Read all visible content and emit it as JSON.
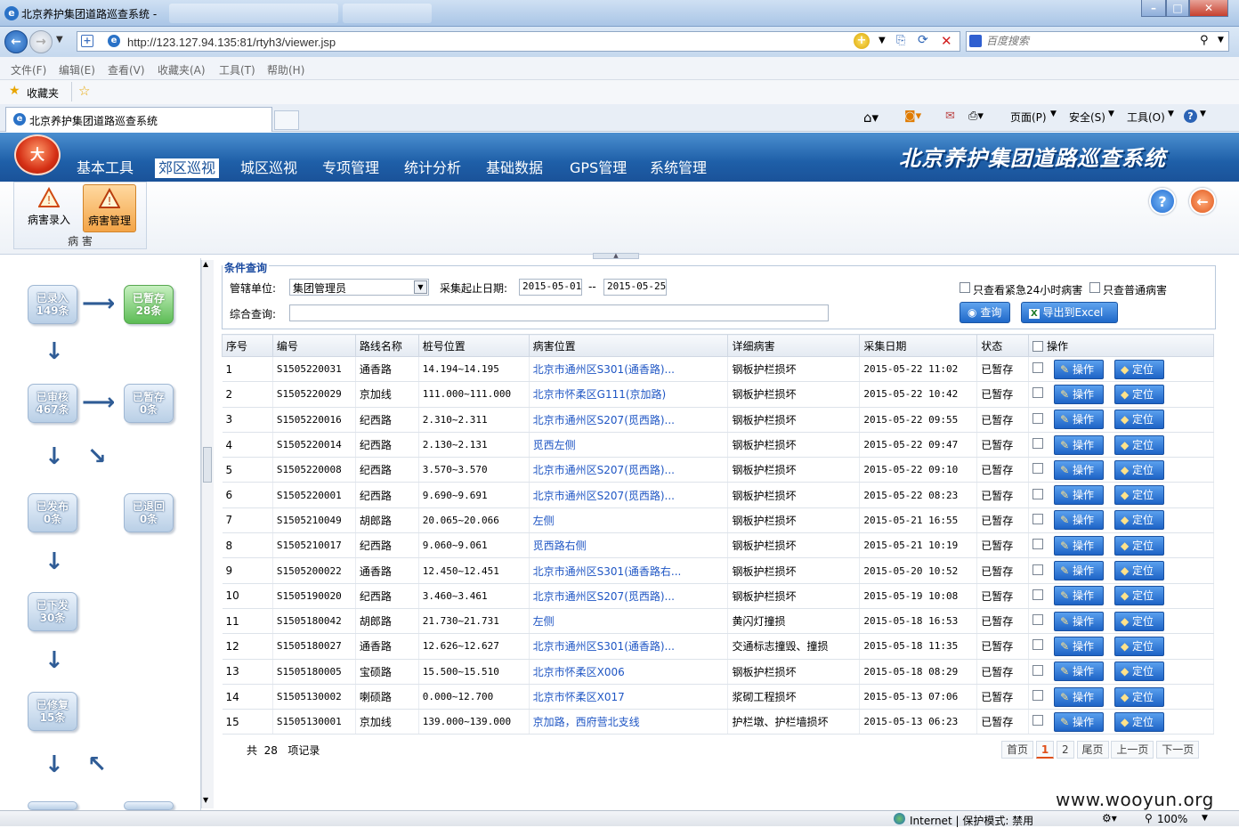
{
  "browser": {
    "window_title": "北京养护集团道路巡查系统 -",
    "address_url": "http://123.127.94.135:81/rtyh3/viewer.jsp",
    "search_placeholder": "百度搜索",
    "menu": [
      "文件(F)",
      "编辑(E)",
      "查看(V)",
      "收藏夹(A)",
      "工具(T)",
      "帮助(H)"
    ],
    "favorites_label": "收藏夹",
    "tab_title": "北京养护集团道路巡查系统",
    "toolbar": {
      "page": "页面(P)",
      "safety": "安全(S)",
      "tools": "工具(O)"
    },
    "status": {
      "zone": "Internet | 保护模式: 禁用",
      "zoom": "100%"
    },
    "colors": {
      "accent": "#1e5fa8",
      "green": "#5cbc55",
      "link": "#1f56c4"
    }
  },
  "app": {
    "logo_text": "大",
    "system_title": "北京养护集团道路巡查系统",
    "nav": [
      "基本工具",
      "郊区巡视",
      "城区巡视",
      "专项管理",
      "统计分析",
      "基础数据",
      "GPS管理",
      "系统管理"
    ],
    "active_nav": "郊区巡视",
    "subtools": [
      "病害录入",
      "病害管理"
    ],
    "group_label": "病 害"
  },
  "flow": {
    "entered": {
      "label": "已录入",
      "count": "149条"
    },
    "saved": {
      "label": "已暂存",
      "count": "28条"
    },
    "reviewed": {
      "label": "已审核",
      "count": "467条"
    },
    "saved2": {
      "label": "已暂存",
      "count": "0条"
    },
    "published": {
      "label": "已发布",
      "count": "0条"
    },
    "returned": {
      "label": "已退回",
      "count": "0条"
    },
    "dispatched": {
      "label": "已下发",
      "count": "30条"
    },
    "repaired": {
      "label": "已修复",
      "count": "15条"
    }
  },
  "query": {
    "legend": "条件查询",
    "unit_label": "管辖单位:",
    "unit_value": "集团管理员",
    "date_label": "采集起止日期:",
    "date_from": "2015-05-01",
    "date_sep": "--",
    "date_to": "2015-05-25",
    "keyword_label": "综合查询:",
    "keyword_value": "",
    "urgent_label": "只查看紧急24小时病害",
    "normal_label": "只查普通病害",
    "search_button": "查询",
    "export_button": "导出到Excel"
  },
  "table": {
    "columns": [
      "序号",
      "编号",
      "路线名称",
      "桩号位置",
      "病害位置",
      "详细病害",
      "采集日期",
      "状态",
      "操作"
    ],
    "op_label": "操作",
    "locate_label": "定位",
    "rows": [
      {
        "no": "1",
        "code": "S1505220031",
        "route": "通香路",
        "stake": "14.194~14.195",
        "loc": "北京市通州区S301(通香路)...",
        "detail": "钢板护栏损坏",
        "date": "2015-05-22 11:02",
        "status": "已暂存"
      },
      {
        "no": "2",
        "code": "S1505220029",
        "route": "京加线",
        "stake": "111.000~111.000",
        "loc": "北京市怀柔区G111(京加路)",
        "detail": "钢板护栏损坏",
        "date": "2015-05-22 10:42",
        "status": "已暂存"
      },
      {
        "no": "3",
        "code": "S1505220016",
        "route": "纪西路",
        "stake": "2.310~2.311",
        "loc": "北京市通州区S207(觅西路)...",
        "detail": "钢板护栏损坏",
        "date": "2015-05-22 09:55",
        "status": "已暂存"
      },
      {
        "no": "4",
        "code": "S1505220014",
        "route": "纪西路",
        "stake": "2.130~2.131",
        "loc": "觅西左侧",
        "detail": "钢板护栏损坏",
        "date": "2015-05-22 09:47",
        "status": "已暂存"
      },
      {
        "no": "5",
        "code": "S1505220008",
        "route": "纪西路",
        "stake": "3.570~3.570",
        "loc": "北京市通州区S207(觅西路)...",
        "detail": "钢板护栏损坏",
        "date": "2015-05-22 09:10",
        "status": "已暂存"
      },
      {
        "no": "6",
        "code": "S1505220001",
        "route": "纪西路",
        "stake": "9.690~9.691",
        "loc": "北京市通州区S207(觅西路)...",
        "detail": "钢板护栏损坏",
        "date": "2015-05-22 08:23",
        "status": "已暂存"
      },
      {
        "no": "7",
        "code": "S1505210049",
        "route": "胡郎路",
        "stake": "20.065~20.066",
        "loc": "左侧",
        "detail": "钢板护栏损坏",
        "date": "2015-05-21 16:55",
        "status": "已暂存"
      },
      {
        "no": "8",
        "code": "S1505210017",
        "route": "纪西路",
        "stake": "9.060~9.061",
        "loc": "觅西路右侧",
        "detail": "钢板护栏损坏",
        "date": "2015-05-21 10:19",
        "status": "已暂存"
      },
      {
        "no": "9",
        "code": "S1505200022",
        "route": "通香路",
        "stake": "12.450~12.451",
        "loc": "北京市通州区S301(通香路右...",
        "detail": "钢板护栏损坏",
        "date": "2015-05-20 10:52",
        "status": "已暂存"
      },
      {
        "no": "10",
        "code": "S1505190020",
        "route": "纪西路",
        "stake": "3.460~3.461",
        "loc": "北京市通州区S207(觅西路)...",
        "detail": "钢板护栏损坏",
        "date": "2015-05-19 10:08",
        "status": "已暂存"
      },
      {
        "no": "11",
        "code": "S1505180042",
        "route": "胡郎路",
        "stake": "21.730~21.731",
        "loc": "左侧",
        "detail": "黄闪灯撞损",
        "date": "2015-05-18 16:53",
        "status": "已暂存"
      },
      {
        "no": "12",
        "code": "S1505180027",
        "route": "通香路",
        "stake": "12.626~12.627",
        "loc": "北京市通州区S301(通香路)...",
        "detail": "交通标志撞毁、撞损",
        "date": "2015-05-18 11:35",
        "status": "已暂存"
      },
      {
        "no": "13",
        "code": "S1505180005",
        "route": "宝硕路",
        "stake": "15.500~15.510",
        "loc": "北京市怀柔区X006",
        "detail": "钢板护栏损坏",
        "date": "2015-05-18 08:29",
        "status": "已暂存"
      },
      {
        "no": "14",
        "code": "S1505130002",
        "route": "喇硕路",
        "stake": "0.000~12.700",
        "loc": "北京市怀柔区X017",
        "detail": "浆砌工程损坏",
        "date": "2015-05-13 07:06",
        "status": "已暂存"
      },
      {
        "no": "15",
        "code": "S1505130001",
        "route": "京加线",
        "stake": "139.000~139.000",
        "loc": "京加路，西府营北支线",
        "detail": "护栏墩、护栏墙损坏",
        "date": "2015-05-13 06:23",
        "status": "已暂存"
      }
    ],
    "total_prefix": "共",
    "total_count": "28",
    "total_suffix": "项记录"
  },
  "pager": {
    "first": "首页",
    "pages": [
      "1",
      "2"
    ],
    "current": "1",
    "last": "尾页",
    "prev": "上一页",
    "next": "下一页"
  },
  "watermark": "www.wooyun.org"
}
